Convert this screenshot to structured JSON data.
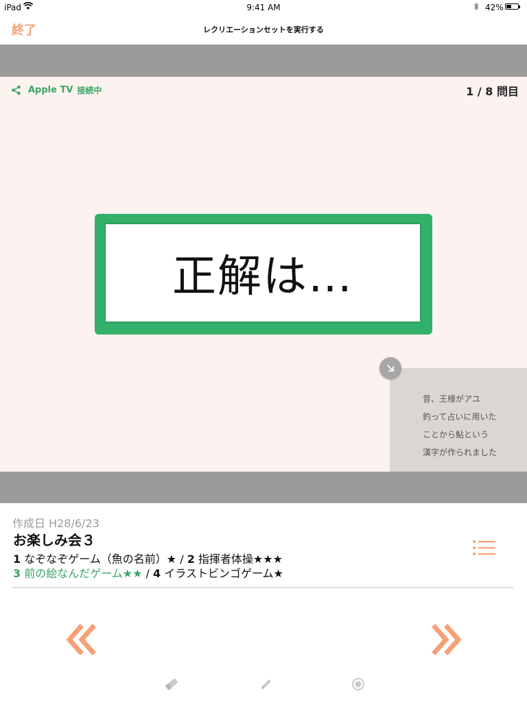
{
  "status_bar": {
    "device": "iPad",
    "time": "9:41 AM",
    "battery": "42%",
    "battery_level": 0.42
  },
  "nav": {
    "end_label": "終了",
    "title": "レクリエーションセットを実行する"
  },
  "stage": {
    "tv_label": "Apple TV",
    "tv_status": "接続中",
    "counter": "1 / 8 問目",
    "answer_text": "正解は…",
    "hint_lines": [
      "昔、王様がアユ",
      "釣って占いに用いた",
      "ことから鮎という",
      "漢字が作られました"
    ]
  },
  "info": {
    "created": "作成日 H28/6/23",
    "title": "お楽しみ会３",
    "games": [
      {
        "num": "1",
        "name": "なぞなぞゲーム（魚の名前）★",
        "current": false
      },
      {
        "num": "2",
        "name": "指揮者体操★★★",
        "current": false
      },
      {
        "num": "3",
        "name": "前の絵なんだゲーム★★",
        "current": true
      },
      {
        "num": "4",
        "name": "イラストビンゴゲーム★",
        "current": false
      }
    ]
  },
  "icons": {
    "share": "share-icon",
    "hint_collapse": "arrow-down-right-icon",
    "list": "list-icon",
    "prev": "double-chevron-left-icon",
    "next": "double-chevron-right-icon",
    "eraser": "eraser-icon",
    "pen": "pen-icon",
    "record": "record-icon"
  },
  "colors": {
    "accent_orange": "#f5a077",
    "accent_green": "#33b06a",
    "band_gray": "#9b9b9b",
    "stage_bg": "#fcf2ef",
    "hint_bg": "#dad6d3"
  }
}
